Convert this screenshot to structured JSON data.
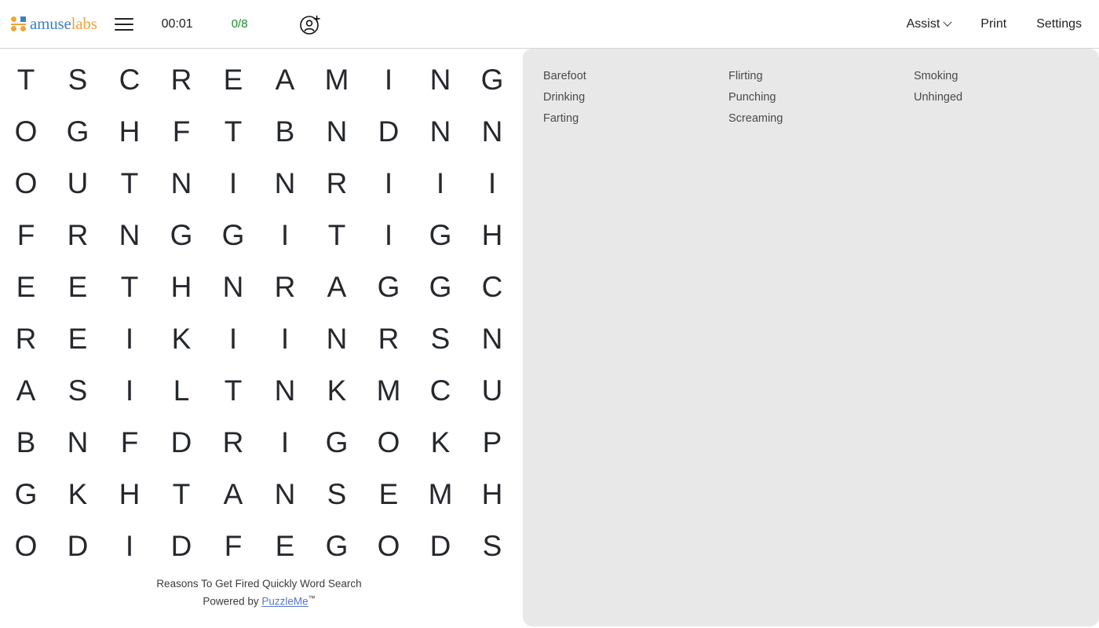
{
  "header": {
    "brand": {
      "name_part1": "amuse",
      "name_part2": "labs",
      "logo_icon": "amuselabs-logo-icon"
    },
    "menu_icon": "hamburger-menu-icon",
    "timer": "00:01",
    "progress": "0/8",
    "progress_color": "#1a8a2e",
    "invite_icon": "add-user-icon",
    "assist_label": "Assist",
    "assist_chevron_icon": "chevron-down-icon",
    "print_label": "Print",
    "settings_label": "Settings"
  },
  "puzzle": {
    "rows": 10,
    "cols": 10,
    "grid": [
      [
        "T",
        "S",
        "C",
        "R",
        "E",
        "A",
        "M",
        "I",
        "N",
        "G"
      ],
      [
        "O",
        "G",
        "H",
        "F",
        "T",
        "B",
        "N",
        "D",
        "N",
        "N"
      ],
      [
        "O",
        "U",
        "T",
        "N",
        "I",
        "N",
        "R",
        "I",
        "I",
        "I"
      ],
      [
        "F",
        "R",
        "N",
        "G",
        "G",
        "I",
        "T",
        "I",
        "G",
        "H"
      ],
      [
        "E",
        "E",
        "T",
        "H",
        "N",
        "R",
        "A",
        "G",
        "G",
        "C"
      ],
      [
        "R",
        "E",
        "I",
        "K",
        "I",
        "I",
        "N",
        "R",
        "S",
        "N"
      ],
      [
        "A",
        "S",
        "I",
        "L",
        "T",
        "N",
        "K",
        "M",
        "C",
        "U"
      ],
      [
        "B",
        "N",
        "F",
        "D",
        "R",
        "I",
        "G",
        "O",
        "K",
        "P"
      ],
      [
        "G",
        "K",
        "H",
        "T",
        "A",
        "N",
        "S",
        "E",
        "M",
        "H"
      ],
      [
        "O",
        "D",
        "I",
        "D",
        "F",
        "E",
        "G",
        "O",
        "D",
        "S"
      ]
    ]
  },
  "footer": {
    "title": "Reasons To Get Fired Quickly Word Search",
    "powered_prefix": "Powered by ",
    "powered_link": "PuzzleMe",
    "trademark": "™"
  },
  "wordlist": {
    "columns": [
      [
        "Barefoot",
        "Drinking",
        "Farting"
      ],
      [
        "Flirting",
        "Punching",
        "Screaming"
      ],
      [
        "Smoking",
        "Unhinged"
      ]
    ],
    "background_color": "#e8e8e8",
    "text_color": "#4a4a4a"
  }
}
